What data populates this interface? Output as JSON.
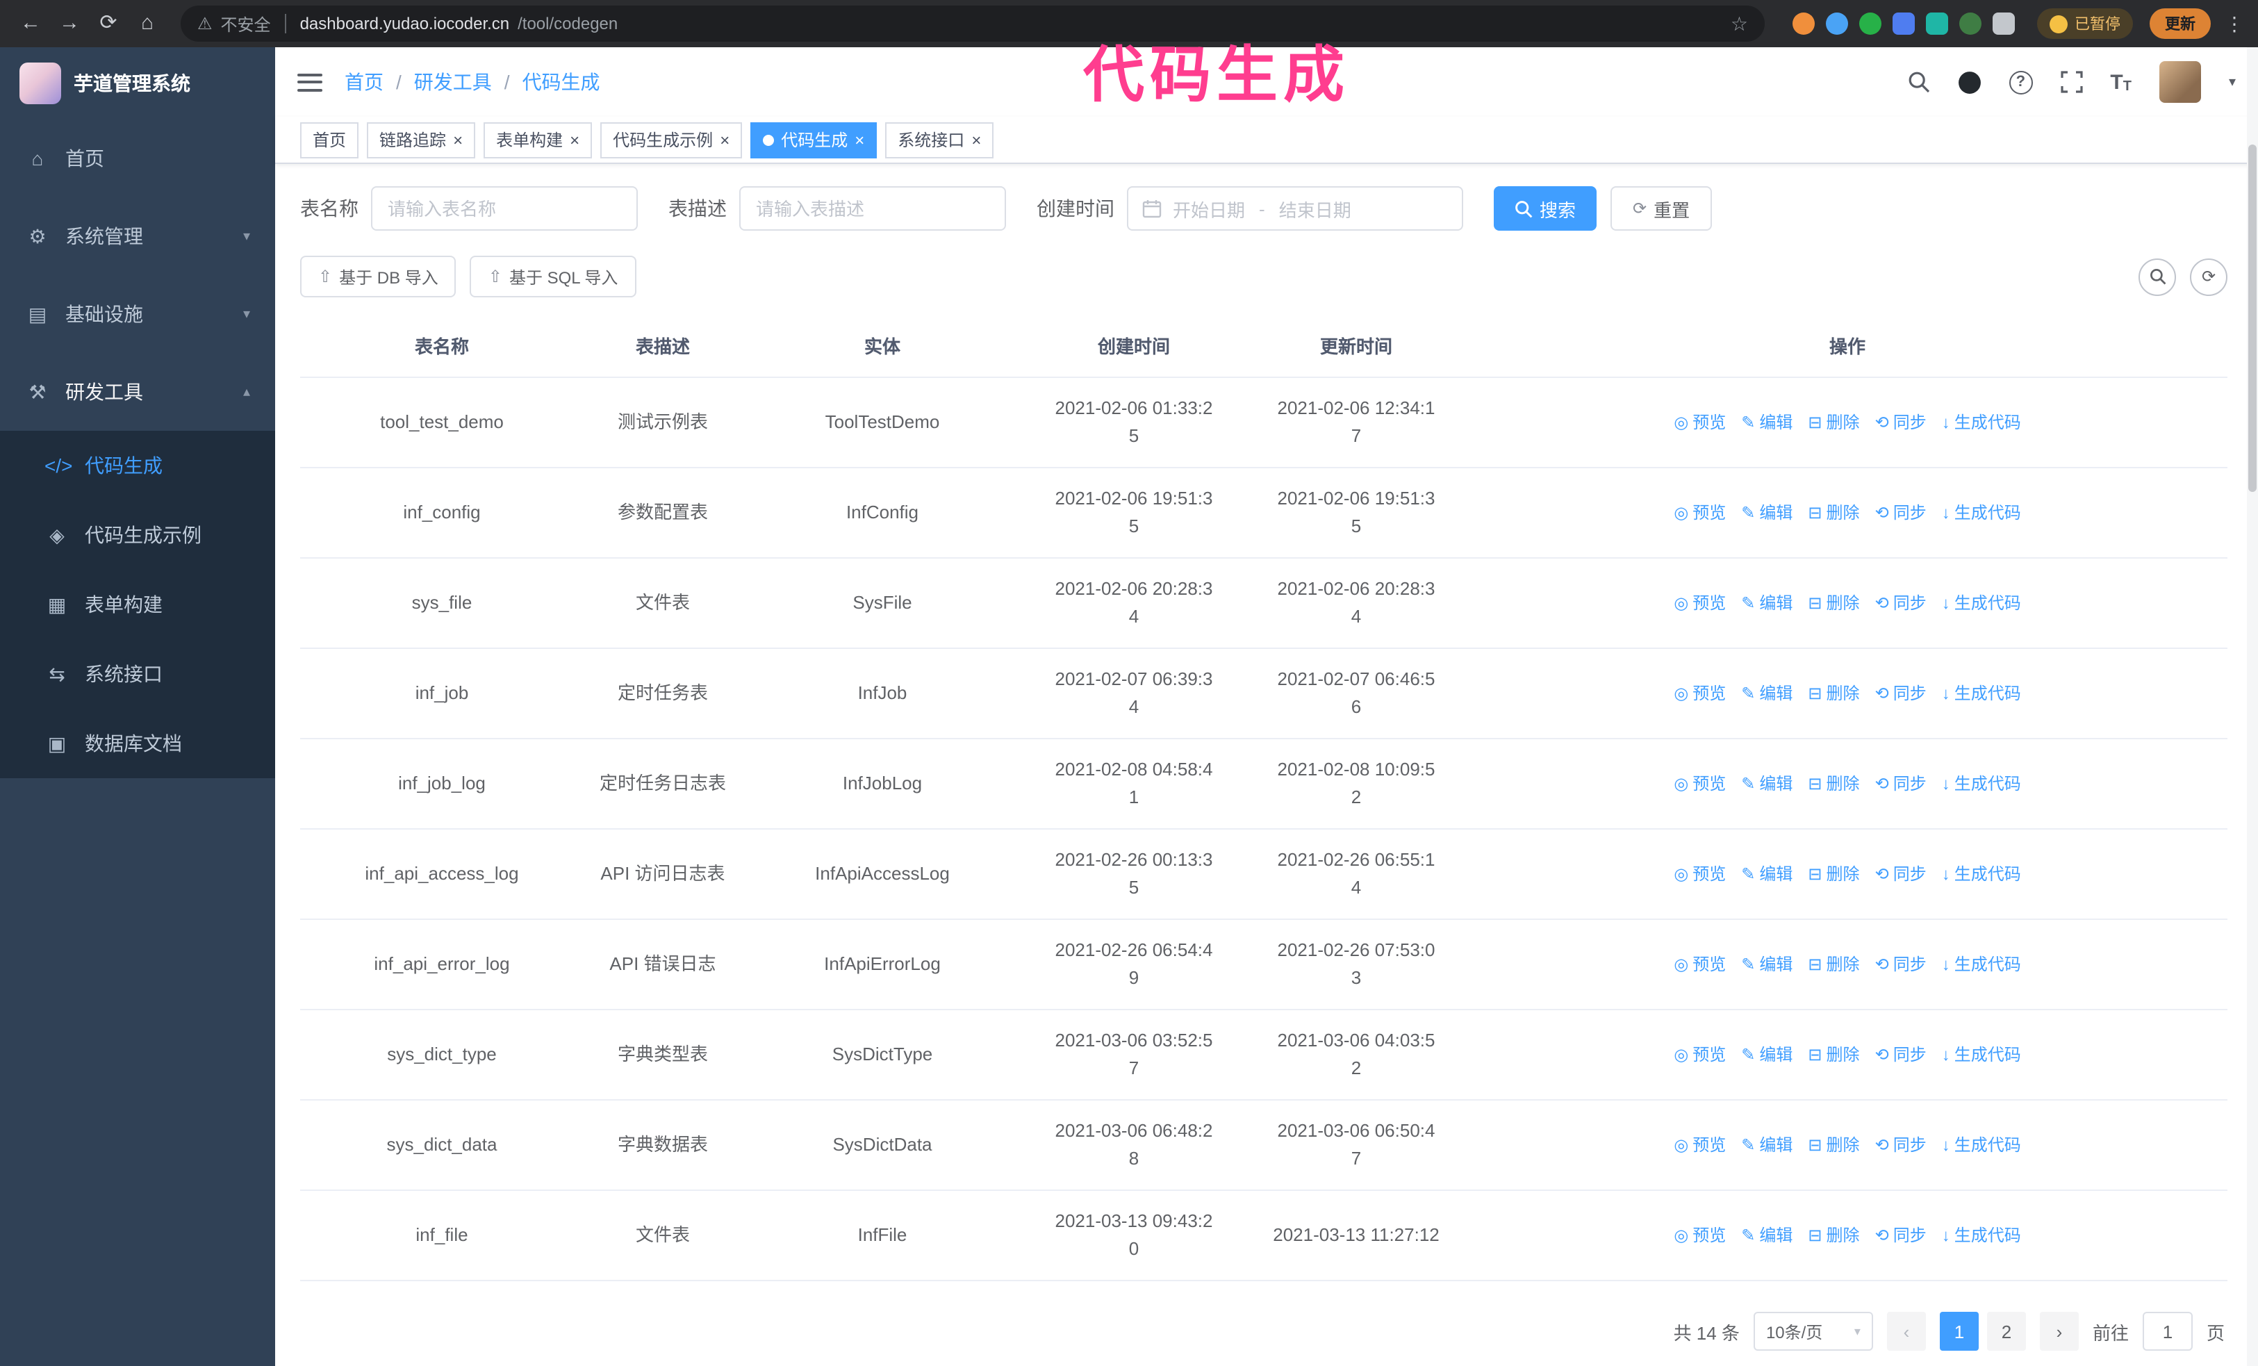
{
  "colors": {
    "primary": "#409eff",
    "sidebar_bg": "#304156",
    "submenu_bg": "#1f2d3d",
    "chrome_bg": "#2b2c2f",
    "update_bg": "#dd8334"
  },
  "annotation": {
    "text": "代码生成",
    "color": "#ff3d8f"
  },
  "icons": {
    "back": "←",
    "forward": "→",
    "reload": "⟳",
    "home_nav": "⌂",
    "warning": "⚠",
    "star": "☆",
    "menu_dots": "⋮",
    "close": "×",
    "chevron_down": "▾",
    "chevron_up": "▴",
    "caret_down": "▾",
    "question": "?",
    "letter_T": "T",
    "home": "⌂",
    "system": "⚙",
    "infra": "▤",
    "tools": "⚒",
    "code": "</>",
    "shield": "◈",
    "form": "▦",
    "api": "⇆",
    "db": "▣",
    "upload": "⇧",
    "refresh": "⟳",
    "eye": "◎",
    "edit": "✎",
    "trash": "⊟",
    "sync": "⟲",
    "download": "↓"
  },
  "browser": {
    "security_label": "不安全",
    "url_host": "dashboard.yudao.iocoder.cn",
    "url_path": "/tool/codegen",
    "paused_label": "已暂停",
    "update_label": "更新",
    "extensions": [
      {
        "color": "#f08f3c",
        "shape": "circle"
      },
      {
        "color": "#4aa3f5",
        "shape": "circle"
      },
      {
        "color": "#27b148",
        "shape": "circle"
      },
      {
        "color": "#4f7df0",
        "shape": "square"
      },
      {
        "color": "#1fb6a6",
        "shape": "square"
      },
      {
        "color": "#3f7d44",
        "shape": "circle"
      },
      {
        "color": "#c3c7cc",
        "shape": "square"
      }
    ]
  },
  "sidebar": {
    "logo_title": "芋道管理系统",
    "items": [
      {
        "key": "home",
        "label": "首页",
        "icon": "home"
      },
      {
        "key": "system",
        "label": "系统管理",
        "icon": "system",
        "expandable": true
      },
      {
        "key": "infra",
        "label": "基础设施",
        "icon": "infra",
        "expandable": true
      },
      {
        "key": "devtools",
        "label": "研发工具",
        "icon": "tools",
        "expandable": true,
        "expanded": true
      }
    ],
    "submenu": [
      {
        "key": "codegen",
        "label": "代码生成",
        "icon": "code",
        "active": true
      },
      {
        "key": "codegen-demo",
        "label": "代码生成示例",
        "icon": "shield"
      },
      {
        "key": "form-builder",
        "label": "表单构建",
        "icon": "form"
      },
      {
        "key": "system-api",
        "label": "系统接口",
        "icon": "api"
      },
      {
        "key": "db-doc",
        "label": "数据库文档",
        "icon": "db"
      }
    ]
  },
  "header": {
    "breadcrumb": [
      "首页",
      "研发工具",
      "代码生成"
    ]
  },
  "tabs": [
    {
      "label": "首页",
      "closable": false
    },
    {
      "label": "链路追踪",
      "closable": true
    },
    {
      "label": "表单构建",
      "closable": true
    },
    {
      "label": "代码生成示例",
      "closable": true
    },
    {
      "label": "代码生成",
      "closable": true,
      "active": true
    },
    {
      "label": "系统接口",
      "closable": true
    }
  ],
  "filters": {
    "table_name_label": "表名称",
    "table_name_placeholder": "请输入表名称",
    "table_desc_label": "表描述",
    "table_desc_placeholder": "请输入表描述",
    "create_time_label": "创建时间",
    "date_start_placeholder": "开始日期",
    "date_separator": "-",
    "date_end_placeholder": "结束日期",
    "search_label": "搜索",
    "reset_label": "重置"
  },
  "toolbar": {
    "import_db_label": "基于 DB 导入",
    "import_sql_label": "基于 SQL 导入"
  },
  "table": {
    "columns": [
      "表名称",
      "表描述",
      "实体",
      "创建时间",
      "更新时间",
      "操作"
    ],
    "actions": [
      {
        "key": "preview",
        "label": "预览",
        "icon": "eye"
      },
      {
        "key": "edit",
        "label": "编辑",
        "icon": "edit"
      },
      {
        "key": "delete",
        "label": "删除",
        "icon": "trash"
      },
      {
        "key": "sync",
        "label": "同步",
        "icon": "sync"
      },
      {
        "key": "generate",
        "label": "生成代码",
        "icon": "download"
      }
    ],
    "rows": [
      {
        "name": "tool_test_demo",
        "desc": "测试示例表",
        "entity": "ToolTestDemo",
        "created": "2021-02-06 01:33:25",
        "updated": "2021-02-06 12:34:17"
      },
      {
        "name": "inf_config",
        "desc": "参数配置表",
        "entity": "InfConfig",
        "created": "2021-02-06 19:51:35",
        "updated": "2021-02-06 19:51:35"
      },
      {
        "name": "sys_file",
        "desc": "文件表",
        "entity": "SysFile",
        "created": "2021-02-06 20:28:34",
        "updated": "2021-02-06 20:28:34"
      },
      {
        "name": "inf_job",
        "desc": "定时任务表",
        "entity": "InfJob",
        "created": "2021-02-07 06:39:34",
        "updated": "2021-02-07 06:46:56"
      },
      {
        "name": "inf_job_log",
        "desc": "定时任务日志表",
        "entity": "InfJobLog",
        "created": "2021-02-08 04:58:41",
        "updated": "2021-02-08 10:09:52"
      },
      {
        "name": "inf_api_access_log",
        "desc": "API 访问日志表",
        "entity": "InfApiAccessLog",
        "created": "2021-02-26 00:13:35",
        "updated": "2021-02-26 06:55:14"
      },
      {
        "name": "inf_api_error_log",
        "desc": "API 错误日志",
        "entity": "InfApiErrorLog",
        "created": "2021-02-26 06:54:49",
        "updated": "2021-02-26 07:53:03"
      },
      {
        "name": "sys_dict_type",
        "desc": "字典类型表",
        "entity": "SysDictType",
        "created": "2021-03-06 03:52:57",
        "updated": "2021-03-06 04:03:52"
      },
      {
        "name": "sys_dict_data",
        "desc": "字典数据表",
        "entity": "SysDictData",
        "created": "2021-03-06 06:48:28",
        "updated": "2021-03-06 06:50:47"
      },
      {
        "name": "inf_file",
        "desc": "文件表",
        "entity": "InfFile",
        "created": "2021-03-13 09:43:20",
        "updated": "2021-03-13 11:27:12"
      }
    ]
  },
  "pagination": {
    "total_label": "共 14 条",
    "page_size_label": "10条/页",
    "prev": "‹",
    "next": "›",
    "pages": [
      "1",
      "2"
    ],
    "active_page": "1",
    "goto_label": "前往",
    "goto_value": "1",
    "page_unit": "页"
  }
}
